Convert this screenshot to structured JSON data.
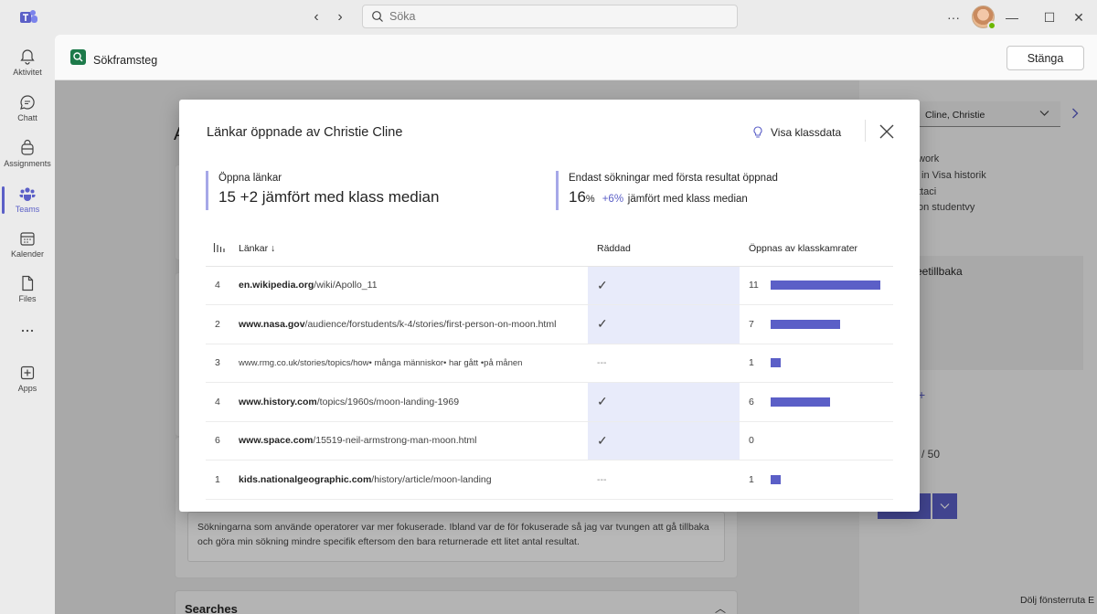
{
  "titlebar": {
    "search_placeholder": "Söka",
    "more_label": "···",
    "minimize_label": "—",
    "maximize_label": "☐",
    "close_label": "✕"
  },
  "rail": {
    "items": [
      {
        "label": "Aktivitet",
        "icon": "bell-icon"
      },
      {
        "label": "Chatt",
        "icon": "chat-icon"
      },
      {
        "label": "Assignments",
        "icon": "backpack-icon"
      },
      {
        "label": "Teams",
        "icon": "teams-icon",
        "active": true
      },
      {
        "label": "Kalender",
        "icon": "calendar-icon"
      },
      {
        "label": "Files",
        "icon": "file-icon"
      },
      {
        "label": "",
        "icon": "more-icon"
      },
      {
        "label": "Apps",
        "icon": "add-apps-icon"
      }
    ]
  },
  "app": {
    "title": "Sökframsteg",
    "close_button": "Stänga"
  },
  "background": {
    "student_name": "Cline, Christie",
    "right_items": [
      "work",
      "in  Visa historik",
      "ttaci",
      "on  studentvy"
    ],
    "right_back": "eetillbaka",
    "score": "/ 50",
    "footer": "Dölj fönsterruta E",
    "reflection": "Sökningarna som använde operatorer var mer fokuserade. Ibland var de för fokuserade så jag var tvungen att gå tillbaka och göra min sökning mindre specifik eftersom den bara returnerade ett litet antal resultat.",
    "searches_title": "Searches",
    "heading_fragment": "A"
  },
  "modal": {
    "title": "Länkar öppnade av Christie Cline",
    "class_data_button": "Visa klassdata",
    "stat_open": {
      "heading": "Öppna länkar",
      "value": "15",
      "comparison": "+2 jämfört med klass median"
    },
    "stat_first": {
      "heading": "Endast sökningar med första resultat öppnad",
      "value": "16",
      "unit": "%",
      "diff": "+6%",
      "comparison": "jämfört med klass median"
    },
    "table": {
      "headers": {
        "links": "Länkar ↓",
        "saved": "Räddad",
        "opened": "Öppnas av klasskamrater"
      },
      "rows": [
        {
          "count": "4",
          "domain": "en.wikipedia.org",
          "path": "/wiki/Apollo_11",
          "saved": "✓",
          "opened": "11",
          "opened_value": 11
        },
        {
          "count": "2",
          "domain": "www.nasa.gov",
          "path": "/audience/forstudents/k-4/stories/first-person-on-moon.html",
          "saved": "✓",
          "opened": "7",
          "opened_value": 7
        },
        {
          "count": "3",
          "domain": "",
          "path": "www.rmg.co.uk/stories/topics/how• många människor• har gått •på månen",
          "saved": "---",
          "opened": "1",
          "opened_value": 1
        },
        {
          "count": "4",
          "domain": "www.history.com",
          "path": "/topics/1960s/moon-landing-1969",
          "saved": "✓",
          "opened": "6",
          "opened_value": 6
        },
        {
          "count": "6",
          "domain": "www.space.com",
          "path": "/15519-neil-armstrong-man-moon.html",
          "saved": "✓",
          "opened": "0",
          "opened_value": 0
        },
        {
          "count": "1",
          "domain": "kids.nationalgeographic.com",
          "path": "/history/article/moon-landing",
          "saved": "---",
          "opened": "1",
          "opened_value": 1
        }
      ]
    }
  },
  "colors": {
    "accent": "#5b5fc7",
    "saved_highlight": "#e8ebfa",
    "stat_border": "#a6a8e8"
  }
}
